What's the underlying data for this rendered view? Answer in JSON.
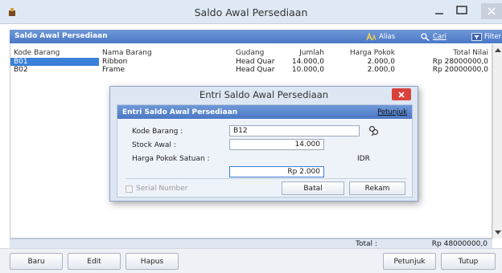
{
  "window": {
    "title": "Saldo Awal Persediaan"
  },
  "header": {
    "title": "Saldo Awal Persediaan",
    "alias_label": "Alias",
    "cari_label": "Cari",
    "filter_label": "Filter"
  },
  "table": {
    "columns": [
      "Kode Barang",
      "Nama Barang",
      "Gudang",
      "Jumlah",
      "Harga Pokok",
      "Total Nilai"
    ],
    "rows": [
      [
        "B01",
        "Ribbon",
        "Head Quar",
        "14.000,0",
        "2.000,0",
        "Rp 28000000,0"
      ],
      [
        "B02",
        "Frame",
        "Head Quar",
        "10.000,0",
        "2.000,0",
        "Rp 20000000,0"
      ]
    ]
  },
  "total": {
    "label": "Total :",
    "value": "Rp 48000000,0"
  },
  "footer": {
    "baru": "Baru",
    "edit": "Edit",
    "hapus": "Hapus",
    "petunjuk": "Petunjuk",
    "tutup": "Tutup"
  },
  "dialog": {
    "title": "Entri Saldo Awal Persediaan",
    "header": "Entri Saldo Awal Persediaan",
    "help_label": "Petunjuk",
    "kode_label": "Kode Barang :",
    "kode_value": "B12",
    "stock_label": "Stock Awal :",
    "stock_value": "14.000",
    "harga_label": "Harga Pokok Satuan :",
    "currency": "IDR",
    "harga_value": "Rp 2.000",
    "serial_label": "Serial Number",
    "batal": "Batal",
    "rekam": "Rekam"
  },
  "colors": {
    "accent": "#4b78c6",
    "selection": "#3a7fd8",
    "close_red": "#d9423b"
  }
}
